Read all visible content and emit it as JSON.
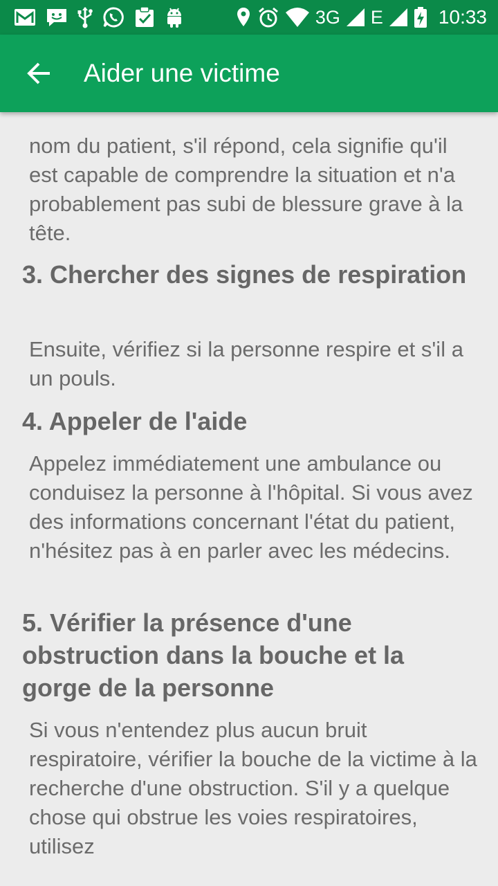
{
  "status_bar": {
    "icons_left": [
      "gmail-icon",
      "chat-icon",
      "usb-icon",
      "whatsapp-icon",
      "clipboard-check-icon",
      "android-icon"
    ],
    "icons_right": [
      "location-icon",
      "alarm-icon",
      "wifi-icon",
      "signal-icon",
      "signal-icon",
      "battery-charging-icon"
    ],
    "network_3g": "3G",
    "network_e": "E",
    "time": "10:33",
    "color": "#0b8a49"
  },
  "app_bar": {
    "title": "Aider une victime",
    "color": "#0da15a",
    "back_icon": "arrow-left-icon"
  },
  "content": {
    "intro_text": "nom du patient, s'il répond, cela signifie qu'il est capable de comprendre la situation et n'a probablement pas subi de blessure grave à la tête.",
    "sections": [
      {
        "heading": "3. Chercher des signes de respiration",
        "body": "Ensuite, vérifiez si la personne respire et s'il a un pouls."
      },
      {
        "heading": "4. Appeler de l'aide",
        "body": "Appelez immédiatement une ambulance ou conduisez la personne à l'hôpital. Si vous avez des informations concernant l'état du patient, n'hésitez pas à en parler avec les médecins."
      },
      {
        "heading": "5. Vérifier la présence d'une obstruction dans la bouche et la gorge de la personne",
        "body": "Si vous n'entendez plus aucun bruit respiratoire, vérifier la bouche de la victime à la recherche d'une obstruction. S'il y a quelque chose qui obstrue les voies respiratoires, utilisez"
      }
    ]
  }
}
